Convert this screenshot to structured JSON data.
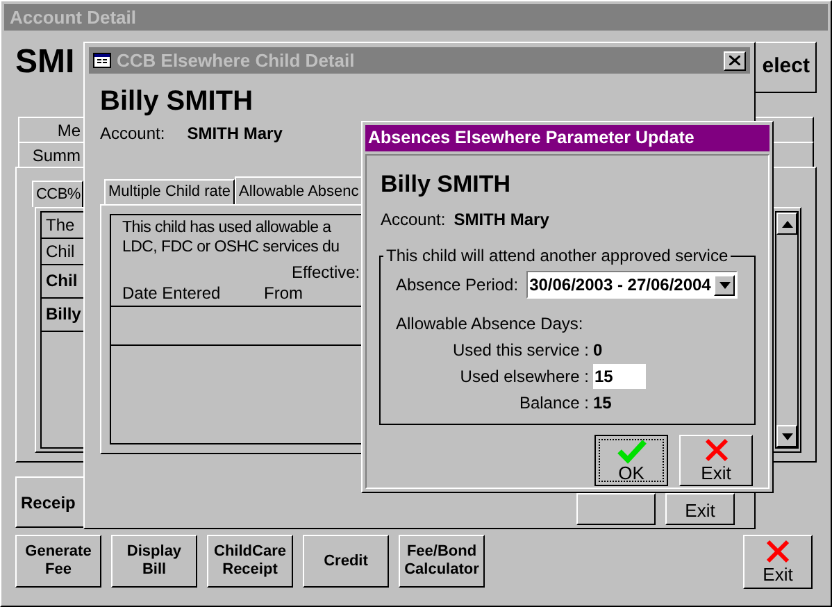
{
  "account_window": {
    "title": "Account Detail",
    "name": "SMI",
    "select_button": "elect",
    "side_tabs": [
      "Me",
      "Summ"
    ],
    "inner_tab": "CCB%",
    "rows": [
      {
        "text": "The",
        "bold": false
      },
      {
        "text": "Chil",
        "bold": false
      },
      {
        "text": "Chil",
        "bold": true
      },
      {
        "text": "Billy",
        "bold": true
      }
    ],
    "receipt_button": "Receip",
    "buttons": [
      "Generate Fee",
      "Display Bill",
      "ChildCare Receipt",
      "Credit",
      "Fee/Bond Calculator"
    ],
    "exit_button": "Exit"
  },
  "child_window": {
    "title": "CCB Elsewhere Child Detail",
    "child_name": "Billy SMITH",
    "account_label": "Account:",
    "account_value": "SMITH Mary",
    "tabs": [
      {
        "label": "Multiple Child rate",
        "selected": false
      },
      {
        "label": "Allowable Absenc",
        "selected": true
      }
    ],
    "message": [
      "This child has used allowable a",
      "LDC, FDC or OSHC services du"
    ],
    "column_group": "Effective:",
    "columns": [
      "Date Entered",
      "From"
    ],
    "exit_button": "Exit"
  },
  "dialog": {
    "title": "Absences Elsewhere Parameter Update",
    "child_name": "Billy SMITH",
    "account_label": "Account:",
    "account_value": "SMITH Mary",
    "group_title": "This child will attend another approved service",
    "absence_period": {
      "label": "Absence Period:",
      "value": "30/06/2003 - 27/06/2004"
    },
    "days_heading": "Allowable Absence Days:",
    "used_this_service": {
      "label": "Used this service :",
      "value": "0"
    },
    "used_elsewhere": {
      "label": "Used elsewhere :",
      "value": "15"
    },
    "balance": {
      "label": "Balance :",
      "value": "15"
    },
    "ok_button": "OK",
    "exit_button": "Exit"
  }
}
